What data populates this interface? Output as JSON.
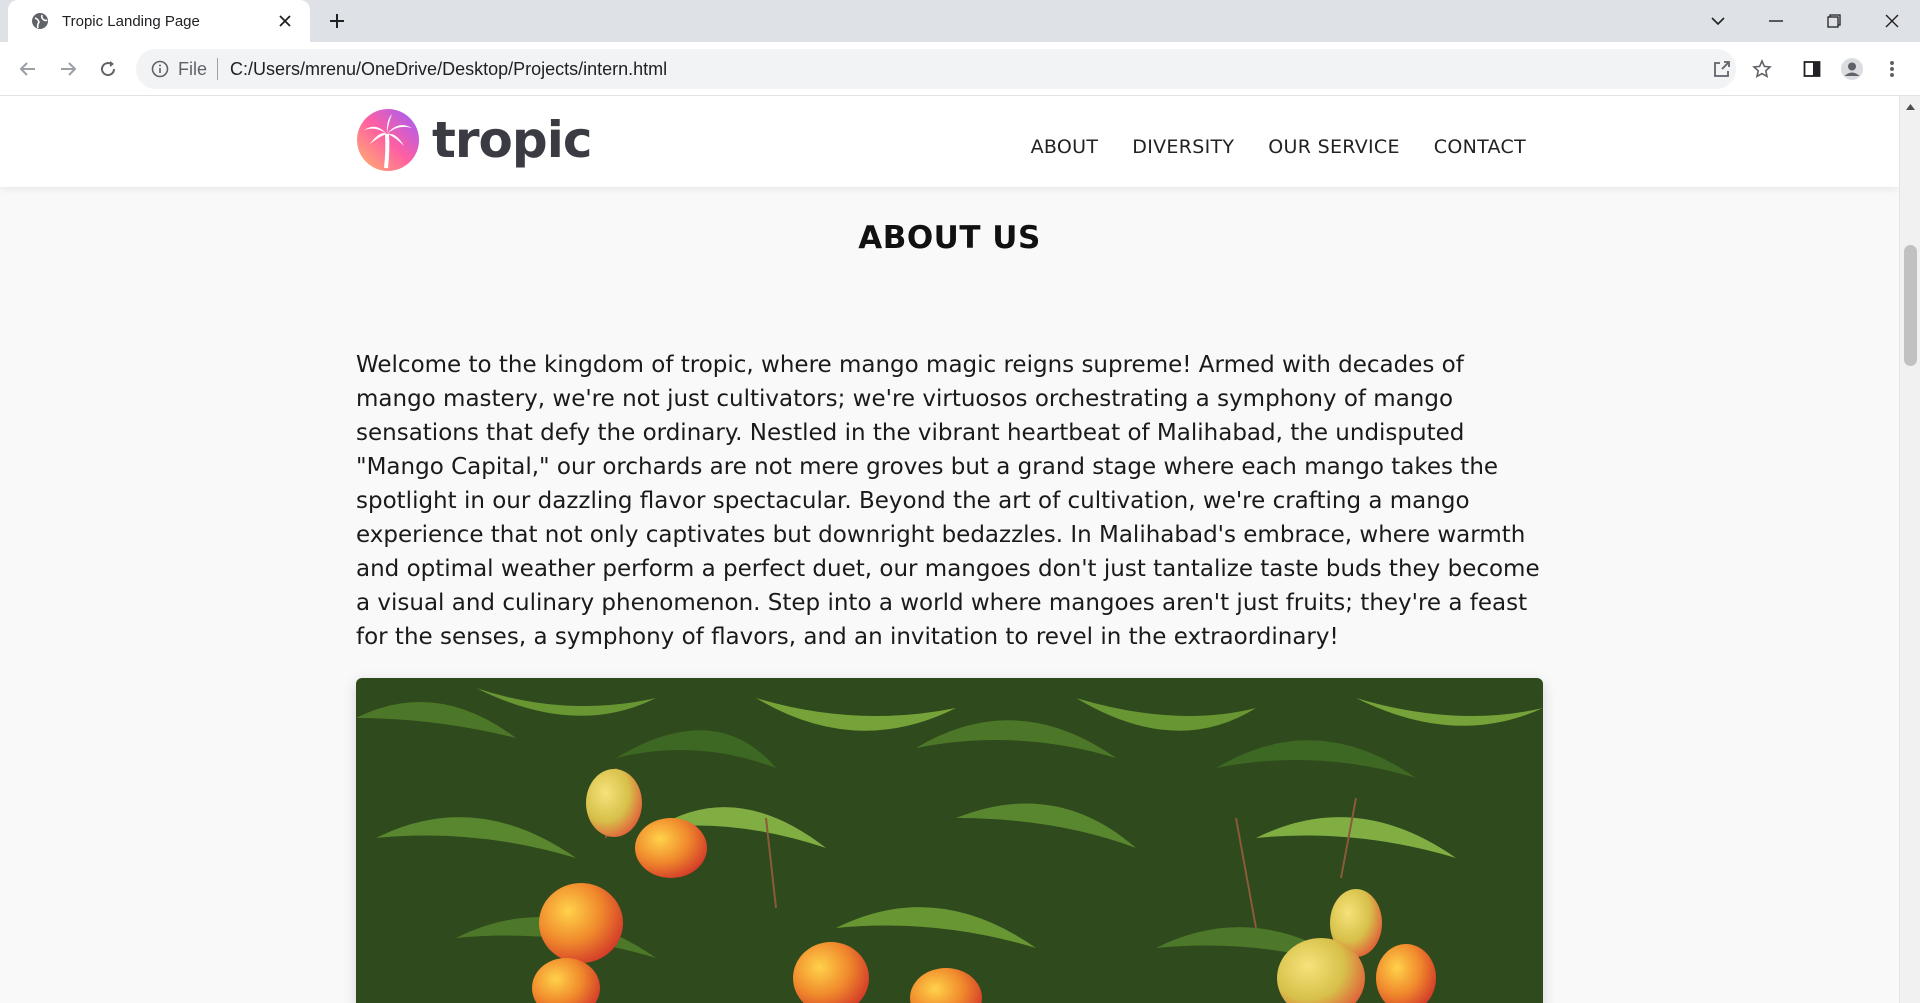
{
  "browser": {
    "tab_title": "Tropic Landing Page",
    "address_scheme": "File",
    "address_url": "C:/Users/mrenu/OneDrive/Desktop/Projects/intern.html"
  },
  "site": {
    "logo_text": "tropic",
    "nav": [
      "ABOUT",
      "DIVERSITY",
      "OUR SERVICE",
      "CONTACT"
    ]
  },
  "about": {
    "title": "ABOUT US",
    "paragraph": "Welcome to the kingdom of tropic, where mango magic reigns supreme! Armed with decades of mango mastery, we're not just cultivators; we're virtuosos orchestrating a symphony of mango sensations that defy the ordinary. Nestled in the vibrant heartbeat of Malihabad, the undisputed \"Mango Capital,\" our orchards are not mere groves but a grand stage where each mango takes the spotlight in our dazzling flavor spectacular. Beyond the art of cultivation, we're crafting a mango experience that not only captivates but downright bedazzles. In Malihabad's embrace, where warmth and optimal weather perform a perfect duet, our mangoes don't just tantalize taste buds they become a visual and culinary phenomenon. Step into a world where mangoes aren't just fruits; they're a feast for the senses, a symphony of flavors, and an invitation to revel in the extraordinary!"
  },
  "colors": {
    "logo_gradient_start": "#ff7a59",
    "logo_gradient_end": "#a259ff",
    "page_background": "#f9f9f9"
  }
}
